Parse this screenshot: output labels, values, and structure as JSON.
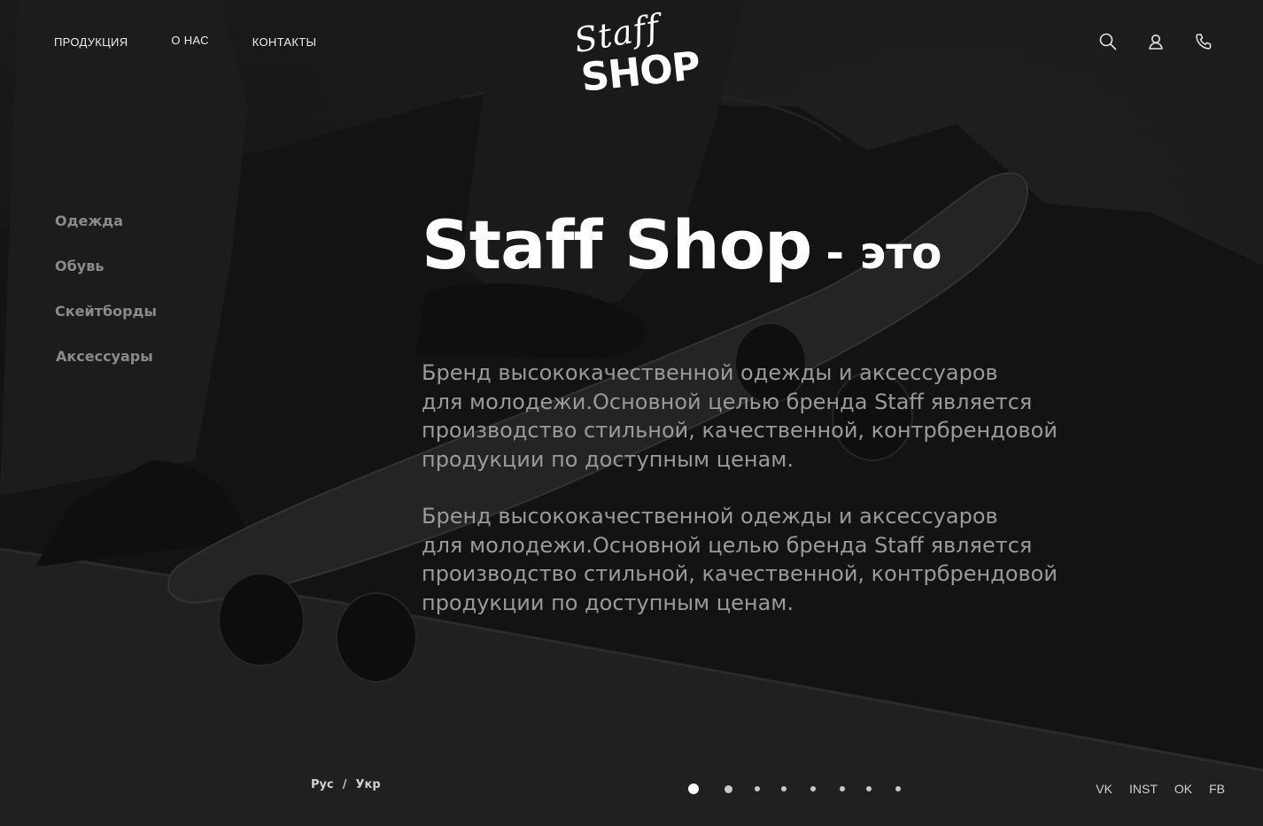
{
  "nav": {
    "items": [
      {
        "label": "ПРОДУКЦИЯ"
      },
      {
        "label": "О НАС"
      },
      {
        "label": "КОНТАКТЫ"
      }
    ]
  },
  "logo": {
    "line1": "Staff",
    "line2": "SHOP"
  },
  "header_icons": [
    "search-icon",
    "user-icon",
    "phone-icon"
  ],
  "side_menu": {
    "items": [
      {
        "label": "Одежда"
      },
      {
        "label": "Обувь"
      },
      {
        "label": "Скейтборды"
      },
      {
        "label": "Аксессуары"
      }
    ]
  },
  "hero": {
    "title": "Staff Shop",
    "title_suffix": "- это",
    "paragraphs": [
      {
        "lines": [
          "Бренд высококачественной одежды и аксессуаров",
          "для молодежи.Основной целью бренда Staff  является",
          "производство стильной, качественной, контрбрендовой",
          "продукции по доступным ценам."
        ]
      },
      {
        "lines": [
          "Бренд высококачественной одежды и аксессуаров",
          "для молодежи.Основной целью бренда Staff  является",
          "производство стильной, качественной, контрбрендовой",
          "продукции по доступным ценам."
        ]
      }
    ]
  },
  "language": {
    "ru": "Рус",
    "separator": "/",
    "uk": "Укр"
  },
  "slider": {
    "count": 8,
    "active": 1
  },
  "social": {
    "items": [
      {
        "label": "VK"
      },
      {
        "label": "INST"
      },
      {
        "label": "OK"
      },
      {
        "label": "FB"
      }
    ]
  },
  "colors": {
    "background": "#1e1e1e",
    "text": "#ffffff",
    "muted": "#8a8a8a",
    "paragraph": "#9a9a9a"
  }
}
